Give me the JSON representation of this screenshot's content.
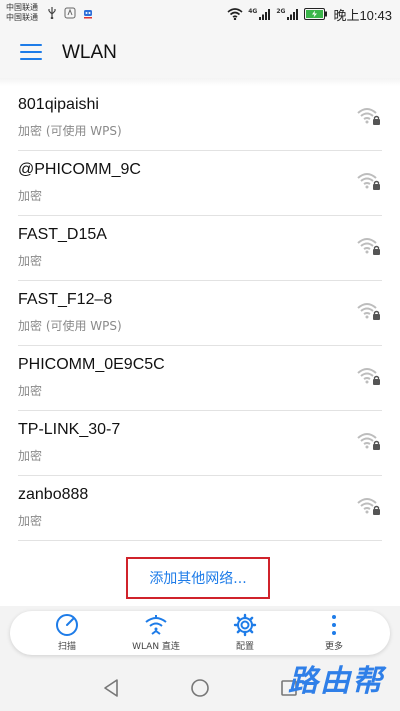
{
  "status_bar": {
    "carrier_1": "中国联通",
    "carrier_2": "中国联通",
    "signal_1_label": "4G",
    "signal_2_label": "2G",
    "time": "晚上10:43"
  },
  "app_bar": {
    "title": "WLAN"
  },
  "networks": [
    {
      "name": "801qipaishi",
      "security": "加密 (可使用 WPS)"
    },
    {
      "name": "@PHICOMM_9C",
      "security": "加密"
    },
    {
      "name": "FAST_D15A",
      "security": "加密"
    },
    {
      "name": "FAST_F12–8",
      "security": "加密 (可使用 WPS)"
    },
    {
      "name": "PHICOMM_0E9C5C",
      "security": "加密"
    },
    {
      "name": "TP-LINK_30-7",
      "security": "加密"
    },
    {
      "name": "zanbo888",
      "security": "加密"
    }
  ],
  "add_network_label": "添加其他网络...",
  "toolbar": {
    "scan_label": "扫描",
    "wlan_direct_label": "WLAN 直连",
    "config_label": "配置",
    "more_label": "更多"
  },
  "watermark_text": "路由帮",
  "colors": {
    "accent": "#1e7ce8",
    "highlight_border": "#d0232b",
    "secondary_text": "#8a8a8a"
  }
}
